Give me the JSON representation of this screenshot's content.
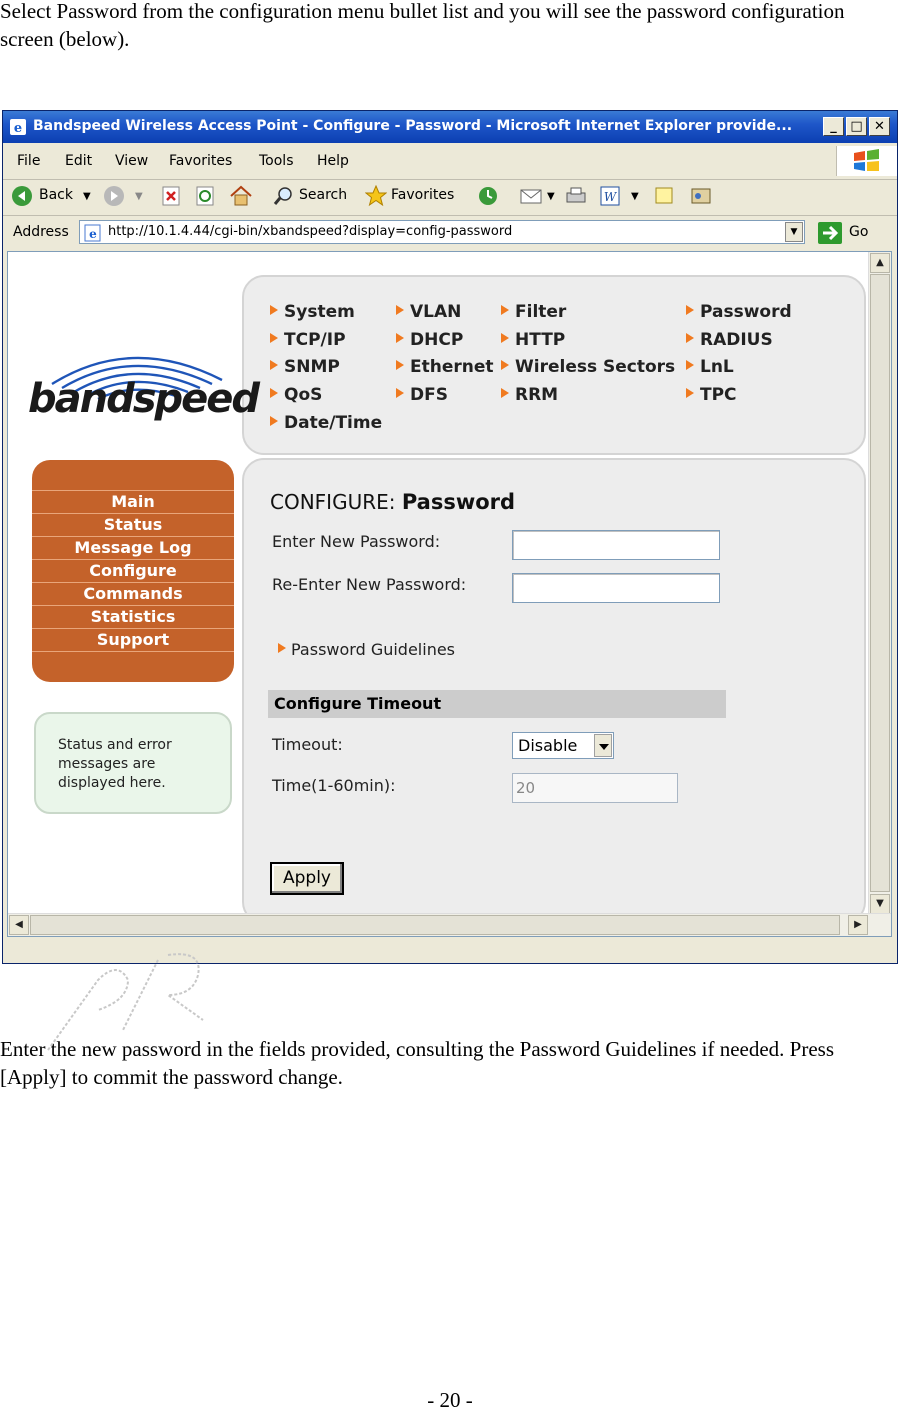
{
  "document": {
    "intro_text": "Select Password from the configuration menu bullet list and you will see the password configuration screen (below).",
    "outro_text": "Enter the new password in the fields provided, consulting the Password Guidelines if needed. Press [Apply] to commit the password change.",
    "page_number": "- 20 -"
  },
  "browser": {
    "title": "Bandspeed Wireless Access Point - Configure - Password - Microsoft Internet Explorer provide...",
    "menu": [
      "File",
      "Edit",
      "View",
      "Favorites",
      "Tools",
      "Help"
    ],
    "toolbar": {
      "back": "Back",
      "search": "Search",
      "favorites": "Favorites"
    },
    "address_label": "Address",
    "address_value": "http://10.1.4.44/cgi-bin/xbandspeed?display=config-password",
    "go_label": "Go"
  },
  "nav_links": [
    [
      "System",
      "VLAN",
      "Filter",
      "Password"
    ],
    [
      "TCP/IP",
      "DHCP",
      "HTTP",
      "RADIUS"
    ],
    [
      "SNMP",
      "Ethernet",
      "Wireless Sectors",
      "LnL"
    ],
    [
      "QoS",
      "DFS",
      "RRM",
      "TPC"
    ],
    [
      "Date/Time"
    ]
  ],
  "logo_text": "bandspeed",
  "left_menu": [
    "Main",
    "Status",
    "Message Log",
    "Configure",
    "Commands",
    "Statistics",
    "Support"
  ],
  "status_box": "Status and error messages are displayed here.",
  "form": {
    "section_prefix": "CONFIGURE:",
    "section_title": "Password",
    "new_password_label": "Enter New Password:",
    "reenter_password_label": "Re-Enter New Password:",
    "guidelines_link": "Password Guidelines",
    "timeout_header": "Configure Timeout",
    "timeout_label": "Timeout:",
    "timeout_value": "Disable",
    "time_label": "Time(1-60min):",
    "time_value": "20",
    "apply_label": "Apply"
  },
  "colors": {
    "accent_orange": "#c4622a",
    "title_blue": "#1f57c9",
    "arrow_orange": "#f07a20"
  }
}
